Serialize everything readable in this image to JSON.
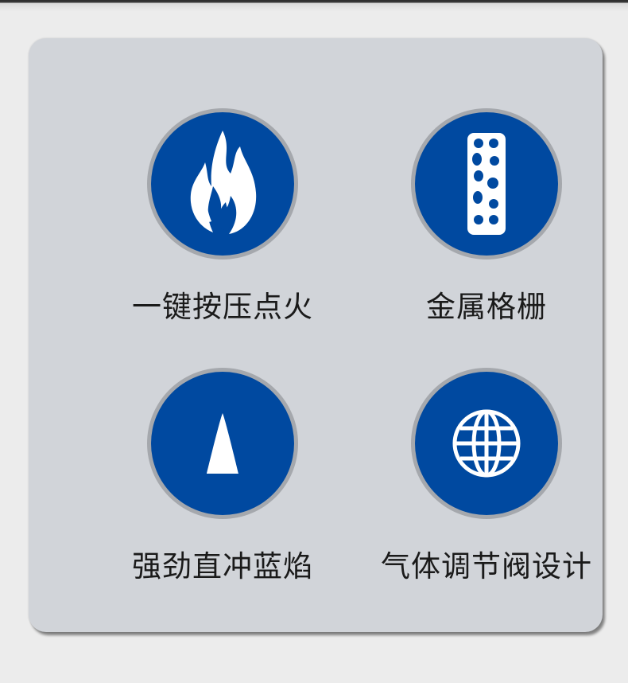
{
  "features": [
    {
      "label": "一键按压点火",
      "icon": "flame-icon"
    },
    {
      "label": "金属格栅",
      "icon": "metal-grate-icon"
    },
    {
      "label": "强劲直冲蓝焰",
      "icon": "blue-flame-cone-icon"
    },
    {
      "label": "气体调节阀设计",
      "icon": "globe-icon"
    }
  ],
  "colors": {
    "icon_circle": "#0049a0",
    "circle_ring": "#a5a8ad",
    "card_background": "#d1d4d9",
    "page_background": "#ececec",
    "icon_foreground": "#ffffff",
    "label_text": "#1a1a1a"
  }
}
